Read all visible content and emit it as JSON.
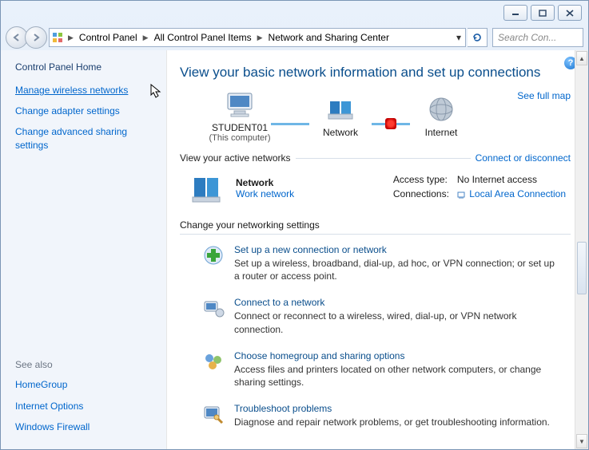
{
  "window": {
    "min_tip": "Minimize",
    "max_tip": "Maximize",
    "close_tip": "Close"
  },
  "breadcrumb": {
    "items": [
      "Control Panel",
      "All Control Panel Items",
      "Network and Sharing Center"
    ]
  },
  "search": {
    "placeholder": "Search Con..."
  },
  "sidebar": {
    "home": "Control Panel Home",
    "links": [
      "Manage wireless networks",
      "Change adapter settings",
      "Change advanced sharing settings"
    ],
    "see_also_label": "See also",
    "see_also": [
      "HomeGroup",
      "Internet Options",
      "Windows Firewall"
    ]
  },
  "page": {
    "title": "View your basic network information and set up connections",
    "full_map": "See full map",
    "diagram": {
      "node1": "STUDENT01",
      "node1_sub": "(This computer)",
      "node2": "Network",
      "node3": "Internet"
    },
    "active_header": "View your active networks",
    "connect_link": "Connect or disconnect",
    "active": {
      "name": "Network",
      "type": "Work network",
      "access_label": "Access type:",
      "access_value": "No Internet access",
      "conn_label": "Connections:",
      "conn_value": "Local Area Connection"
    },
    "settings_header": "Change your networking settings",
    "tasks": [
      {
        "title": "Set up a new connection or network",
        "desc": "Set up a wireless, broadband, dial-up, ad hoc, or VPN connection; or set up a router or access point."
      },
      {
        "title": "Connect to a network",
        "desc": "Connect or reconnect to a wireless, wired, dial-up, or VPN network connection."
      },
      {
        "title": "Choose homegroup and sharing options",
        "desc": "Access files and printers located on other network computers, or change sharing settings."
      },
      {
        "title": "Troubleshoot problems",
        "desc": "Diagnose and repair network problems, or get troubleshooting information."
      }
    ]
  }
}
